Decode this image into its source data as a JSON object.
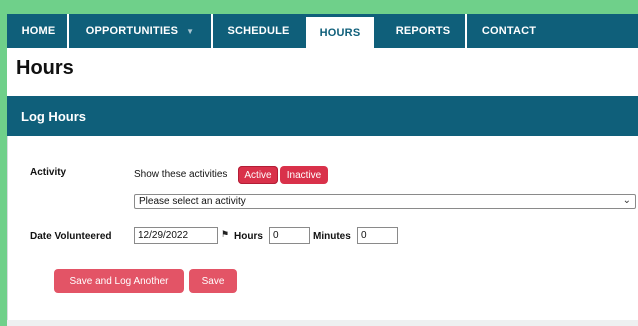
{
  "nav": {
    "tabs": [
      {
        "label": "HOME"
      },
      {
        "label": "OPPORTUNITIES"
      },
      {
        "label": "SCHEDULE"
      },
      {
        "label": "HOURS"
      },
      {
        "label": "REPORTS"
      },
      {
        "label": "CONTACT"
      }
    ],
    "active_tab": "HOURS",
    "dropdown_icon": "caret-down-icon"
  },
  "page": {
    "title": "Hours"
  },
  "panel": {
    "heading": "Log Hours"
  },
  "form": {
    "activity": {
      "label": "Activity",
      "filter_text": "Show these activities",
      "filters": [
        {
          "label": "Active"
        },
        {
          "label": "Inactive"
        }
      ],
      "select_value": "Please select an activity"
    },
    "date": {
      "label": "Date Volunteered",
      "value": "12/29/2022",
      "picker_icon": "flag-icon"
    },
    "hours": {
      "label": "Hours",
      "value": "0"
    },
    "minutes": {
      "label": "Minutes",
      "value": "0"
    }
  },
  "actions": {
    "save_and_log_another": "Save and Log Another",
    "save": "Save"
  },
  "colors": {
    "nav_bg": "#0f5f7a",
    "accent_button": "#e35466",
    "filter_pill": "#d9314a",
    "frame_green": "#6fd08a"
  }
}
